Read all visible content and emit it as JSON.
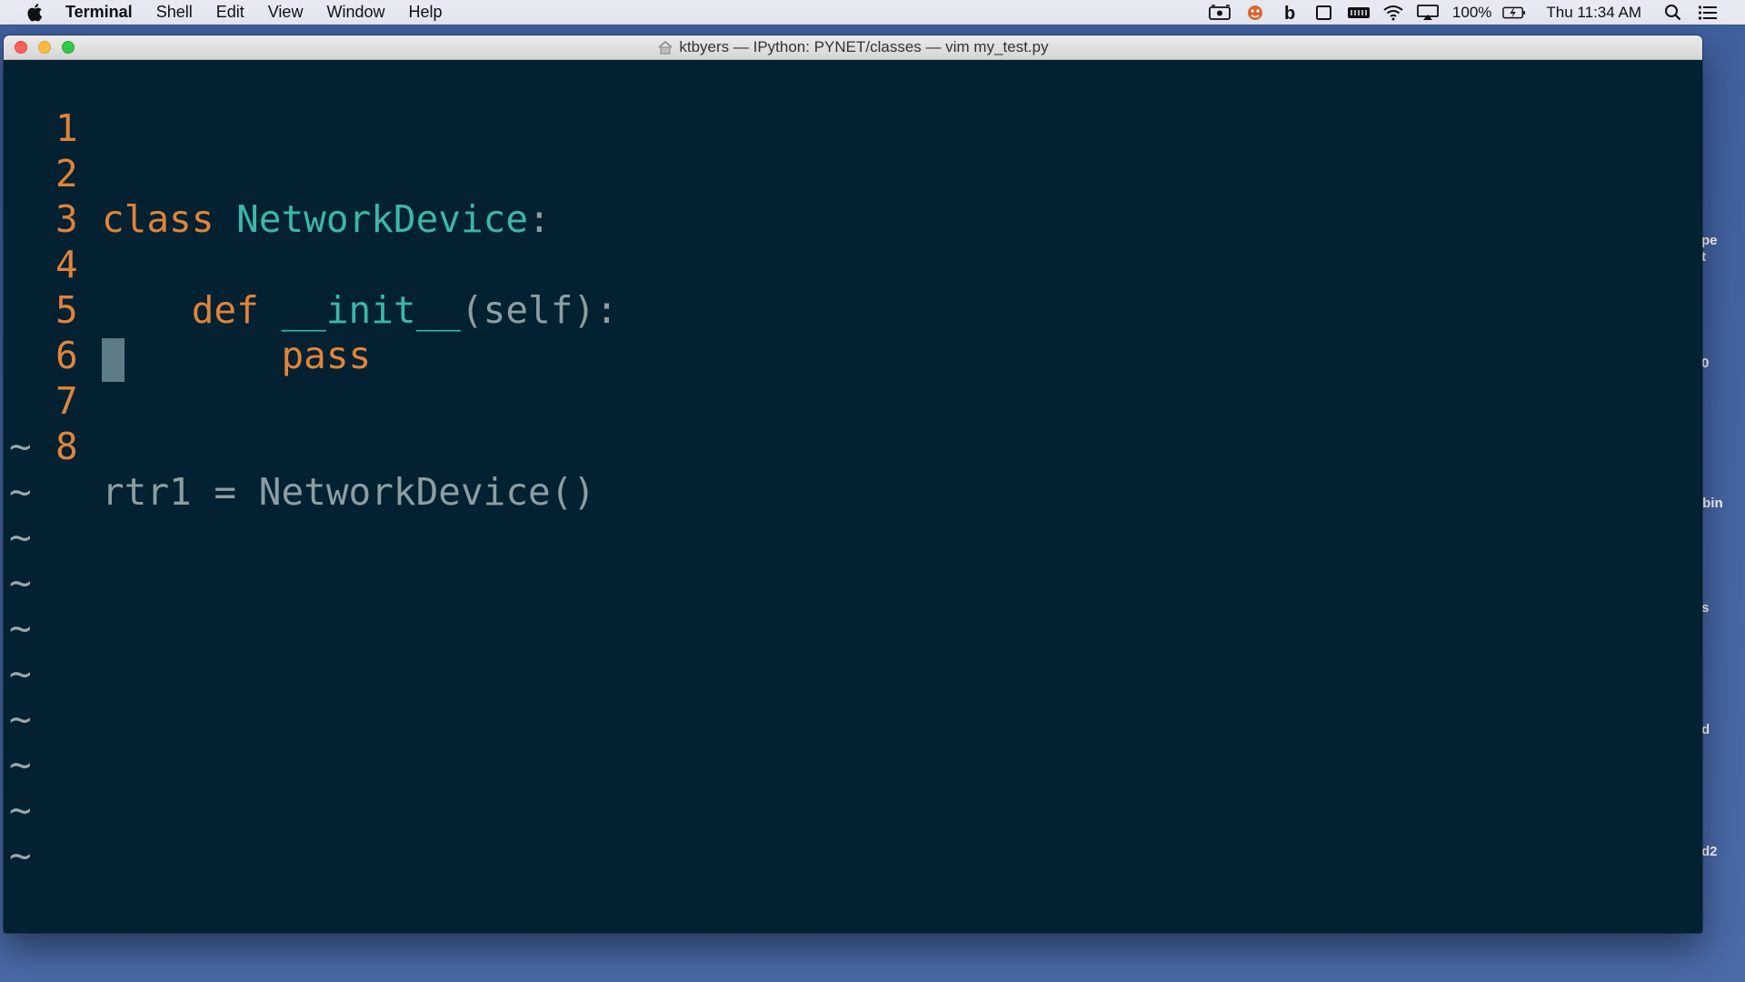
{
  "menubar": {
    "app_name": "Terminal",
    "items": [
      "Shell",
      "Edit",
      "View",
      "Window",
      "Help"
    ],
    "battery": "100%",
    "clock": "Thu 11:34 AM",
    "status_icons": [
      "screen-record-icon",
      "app-helper-icon",
      "bold-b-icon",
      "window-icon",
      "keyboard-icon",
      "wifi-icon",
      "airplay-icon",
      "battery-icon",
      "spotlight-icon",
      "notification-center-icon"
    ]
  },
  "window": {
    "title": "ktbyers — IPython: PYNET/classes — vim my_test.py"
  },
  "editor": {
    "lines": [
      {
        "number": "1",
        "tokens": []
      },
      {
        "number": "2",
        "tokens": [
          {
            "text": "class ",
            "kind": "kw"
          },
          {
            "text": "NetworkDevice",
            "kind": "cls"
          },
          {
            "text": ":",
            "kind": "plain"
          }
        ]
      },
      {
        "number": "3",
        "tokens": []
      },
      {
        "number": "4",
        "tokens": [
          {
            "text": "    def ",
            "kind": "kw"
          },
          {
            "text": "__init__",
            "kind": "cls"
          },
          {
            "text": "(self):",
            "kind": "plain"
          }
        ]
      },
      {
        "number": "5",
        "tokens": [
          {
            "text": "        pass",
            "kind": "kw"
          }
        ]
      },
      {
        "number": "6",
        "tokens": []
      },
      {
        "number": "7",
        "tokens": []
      },
      {
        "number": "8",
        "tokens": [
          {
            "text": "rtr1 = NetworkDevice()",
            "kind": "plain"
          }
        ]
      }
    ],
    "cursor_line": "7",
    "tilde": "~",
    "tilde_count": 10
  },
  "desktop_labels": [
    "pe",
    "t",
    "0",
    ".bin",
    "s",
    "d",
    "d2"
  ],
  "colors": {
    "background": "#032131",
    "keyword": "#e0843a",
    "class_name": "#3db6a8",
    "plain": "#8b9ea3",
    "line_number": "#e0843a"
  }
}
